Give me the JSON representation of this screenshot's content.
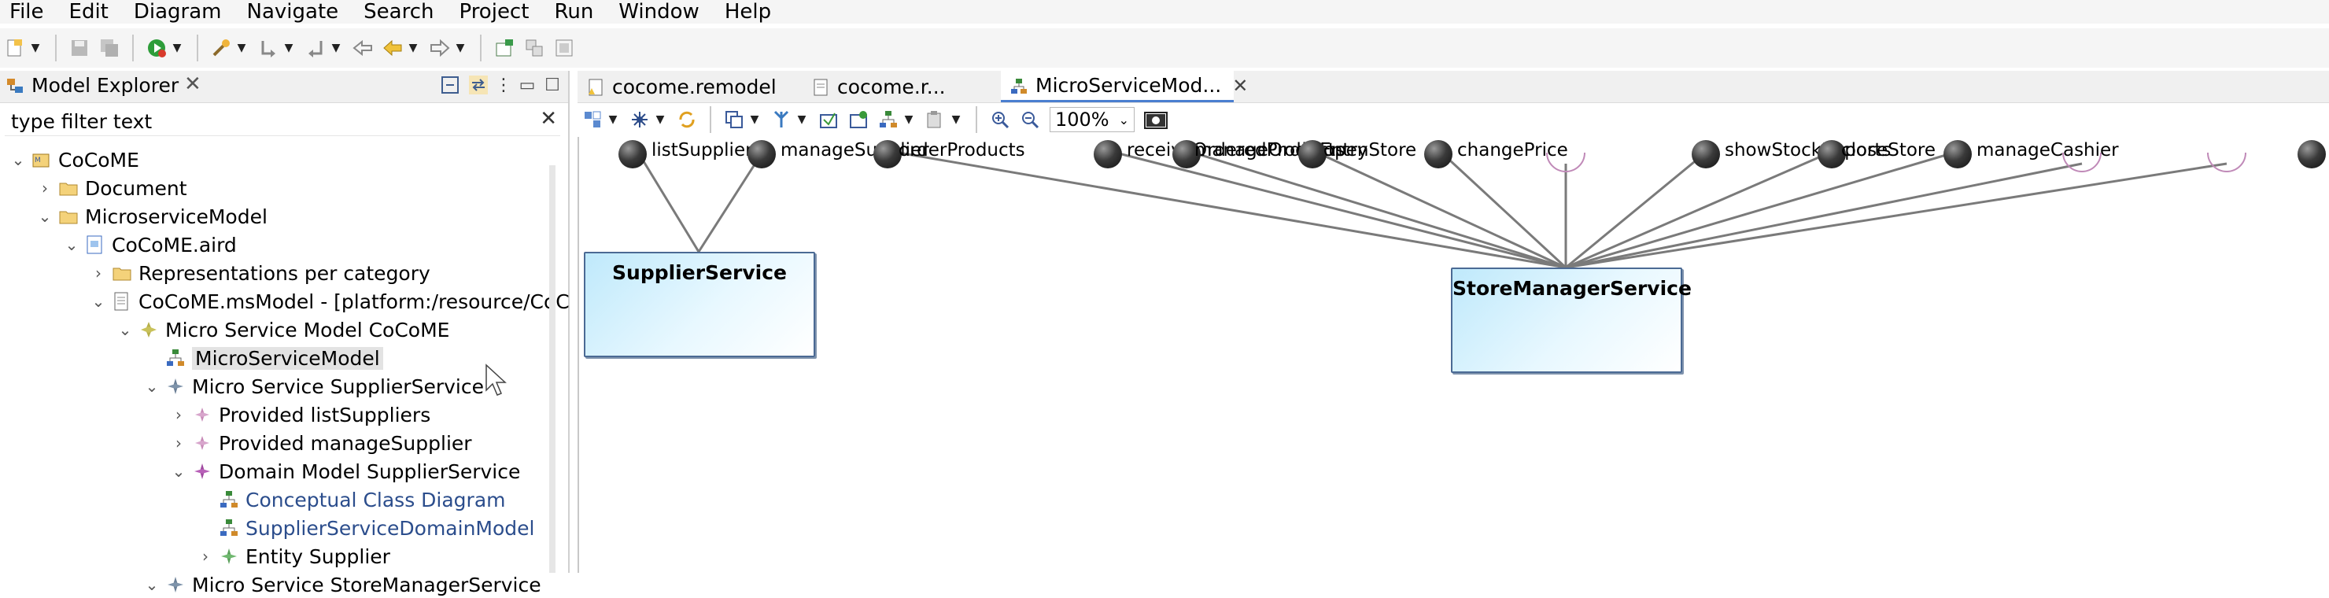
{
  "menu": [
    "File",
    "Edit",
    "Diagram",
    "Navigate",
    "Search",
    "Project",
    "Run",
    "Window",
    "Help"
  ],
  "explorer": {
    "title": "Model Explorer",
    "filter_placeholder": "type filter text",
    "tree": [
      {
        "label": "CoCoME",
        "level": 0,
        "twisty": "⌄",
        "icon": "project-icon"
      },
      {
        "label": "Document",
        "level": 1,
        "twisty": "›",
        "icon": "folder-icon"
      },
      {
        "label": "MicroserviceModel",
        "level": 1,
        "twisty": "⌄",
        "icon": "folder-icon"
      },
      {
        "label": "CoCoME.aird",
        "level": 2,
        "twisty": "⌄",
        "icon": "aird-file-icon"
      },
      {
        "label": "Representations per category",
        "level": 3,
        "twisty": "›",
        "icon": "folder-icon"
      },
      {
        "label": "CoCoME.msModel - [platform:/resource/CoC",
        "level": 3,
        "twisty": "⌄",
        "icon": "model-file-icon"
      },
      {
        "label": "Micro Service Model CoCoME",
        "level": 4,
        "twisty": "⌄",
        "icon": "model-element-icon"
      },
      {
        "label": "MicroServiceModel",
        "level": 5,
        "twisty": "",
        "icon": "diagram-icon",
        "selected": true
      },
      {
        "label": "Micro Service SupplierService",
        "level": 5,
        "twisty": "⌄",
        "icon": "service-element-icon"
      },
      {
        "label": "Provided listSuppliers",
        "level": 6,
        "twisty": "›",
        "icon": "provided-icon"
      },
      {
        "label": "Provided manageSupplier",
        "level": 6,
        "twisty": "›",
        "icon": "provided-icon"
      },
      {
        "label": "Domain Model SupplierService",
        "level": 6,
        "twisty": "⌄",
        "icon": "domain-icon"
      },
      {
        "label": "Conceptual Class Diagram",
        "level": 7,
        "twisty": "",
        "icon": "diagram-icon",
        "link": true
      },
      {
        "label": "SupplierServiceDomainModel",
        "level": 7,
        "twisty": "",
        "icon": "diagram-icon",
        "link": true
      },
      {
        "label": "Entity Supplier",
        "level": 7,
        "twisty": "›",
        "icon": "entity-icon"
      },
      {
        "label": "Micro Service StoreManagerService",
        "level": 5,
        "twisty": "⌄",
        "icon": "service-element-icon"
      }
    ]
  },
  "editor": {
    "tabs": [
      {
        "label": "cocome.remodel",
        "active": false,
        "closable": false,
        "icon": "remodel-file-icon"
      },
      {
        "label": "cocome.r...",
        "active": false,
        "closable": false,
        "icon": "remodel-file-icon"
      },
      {
        "label": "MicroServiceMod...",
        "active": true,
        "closable": true,
        "icon": "diagram-icon"
      }
    ],
    "zoom": "100%",
    "diagram": {
      "services": [
        "SupplierService",
        "StoreManagerService"
      ],
      "ports": [
        "listSuppliers",
        "manageSupplier",
        "orderProducts",
        "receiveOrderedProducts",
        "manageOrderEntry",
        "openStore",
        "changePrice",
        "showStockReports",
        "closeStore",
        "manageCashier"
      ]
    }
  },
  "colors": {
    "service_border": "#4b6a94",
    "service_fill": "#d6f2fd",
    "link": "#7a7a7a",
    "link_required": "#c08ab8"
  }
}
